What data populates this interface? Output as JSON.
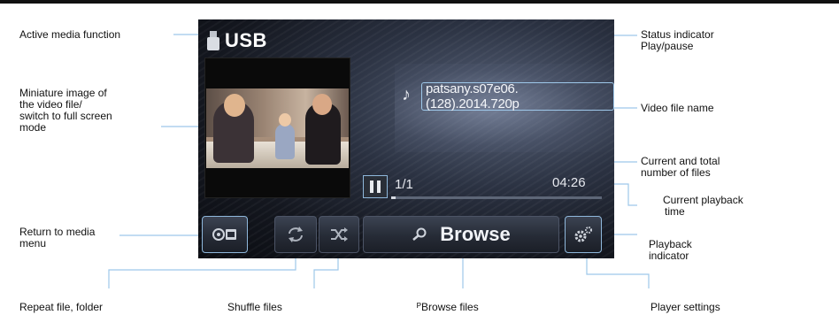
{
  "labels": {
    "active_media": "Active media function",
    "miniature": [
      "Miniature image of",
      "the video file/",
      "switch to full screen",
      "mode"
    ],
    "return_media": [
      "Return to media",
      "menu"
    ],
    "repeat": "Repeat file, folder",
    "shuffle": "Shuffle files",
    "browse_files": "ᴾBrowse files",
    "player_settings": "Player settings",
    "status_indicator": [
      "Status indicator",
      "Play/pause"
    ],
    "video_file_name": "Video file name",
    "current_total": [
      "Current and total",
      "number of files"
    ],
    "current_time": [
      "Current playback",
      "time"
    ],
    "playback_indicator": [
      "Playback",
      "indicator"
    ]
  },
  "screen": {
    "source": "USB",
    "filename": "patsany.s07e06.(128).2014.720p",
    "file_counter": "1/1",
    "playback_time": "04:26",
    "progress_fraction": 0.02,
    "browse_label": "Browse",
    "state": "paused"
  },
  "icons": [
    "usb-icon",
    "music-note-icon",
    "pause-icon",
    "media-menu-icon",
    "repeat-icon",
    "shuffle-icon",
    "search-icon",
    "settings-icon"
  ],
  "colors": {
    "accent": "#8fb8dc",
    "callout": "#9ec8ea"
  }
}
